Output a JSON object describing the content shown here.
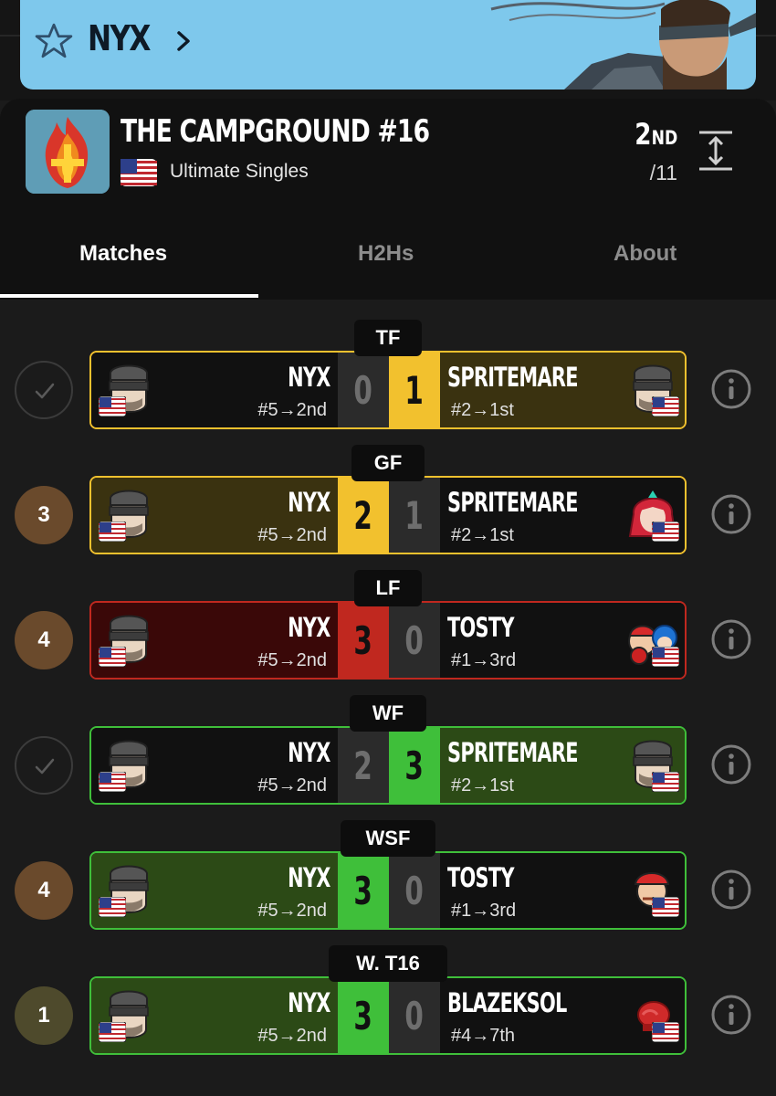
{
  "banner": {
    "player_name": "NYX",
    "color": "#7ec8ec",
    "icons": [
      "star-icon",
      "chevron-right-icon"
    ]
  },
  "event": {
    "title": "THE CAMPGROUND #16",
    "subtitle": "Ultimate Singles",
    "country_flag": "us-flag-icon",
    "placement_number": "2",
    "placement_suffix": "ND",
    "entrants": "/11"
  },
  "tabs": [
    {
      "label": "Matches",
      "active": true
    },
    {
      "label": "H2Hs",
      "active": false
    },
    {
      "label": "About",
      "active": false
    }
  ],
  "colors": {
    "loss_card": "#3a3210",
    "win_green": "#2c4a16",
    "loss_red": "#3a0808",
    "gold_accent": "#f2c12e",
    "green_accent": "#3fbf3a",
    "red_accent": "#c0281f",
    "bronze_circle": "#6a4a2c",
    "olive_circle": "#4e4a2c"
  },
  "matches": [
    {
      "round": "TF",
      "left_marker": "check",
      "left_marker_text": "",
      "p1": {
        "name": "NYX",
        "seed": "#5→2nd",
        "score": "0",
        "character": "snake"
      },
      "p2": {
        "name": "SPRITEMARE",
        "seed": "#2→1st",
        "score": "1",
        "character": "snake"
      }
    },
    {
      "round": "GF",
      "left_marker": "number",
      "left_marker_text": "3",
      "p1": {
        "name": "NYX",
        "seed": "#5→2nd",
        "score": "2",
        "character": "snake"
      },
      "p2": {
        "name": "SPRITEMARE",
        "seed": "#2→1st",
        "score": "1",
        "character": "pyra"
      }
    },
    {
      "round": "LF",
      "left_marker": "number",
      "left_marker_text": "4",
      "p1": {
        "name": "NYX",
        "seed": "#5→2nd",
        "score": "3",
        "character": "snake"
      },
      "p2": {
        "name": "TOSTY",
        "seed": "#1→3rd",
        "score": "0",
        "character": "mac-megaman"
      }
    },
    {
      "round": "WF",
      "left_marker": "check",
      "left_marker_text": "",
      "p1": {
        "name": "NYX",
        "seed": "#5→2nd",
        "score": "2",
        "character": "snake"
      },
      "p2": {
        "name": "SPRITEMARE",
        "seed": "#2→1st",
        "score": "3",
        "character": "snake"
      }
    },
    {
      "round": "WSF",
      "left_marker": "number",
      "left_marker_text": "4",
      "p1": {
        "name": "NYX",
        "seed": "#5→2nd",
        "score": "3",
        "character": "snake"
      },
      "p2": {
        "name": "TOSTY",
        "seed": "#1→3rd",
        "score": "0",
        "character": "mac"
      }
    },
    {
      "round": "W. T16",
      "left_marker": "number",
      "left_marker_text": "1",
      "p1": {
        "name": "NYX",
        "seed": "#5→2nd",
        "score": "3",
        "character": "snake"
      },
      "p2": {
        "name": "BLAZEKSOL",
        "seed": "#4→7th",
        "score": "0",
        "character": "glove"
      }
    }
  ]
}
